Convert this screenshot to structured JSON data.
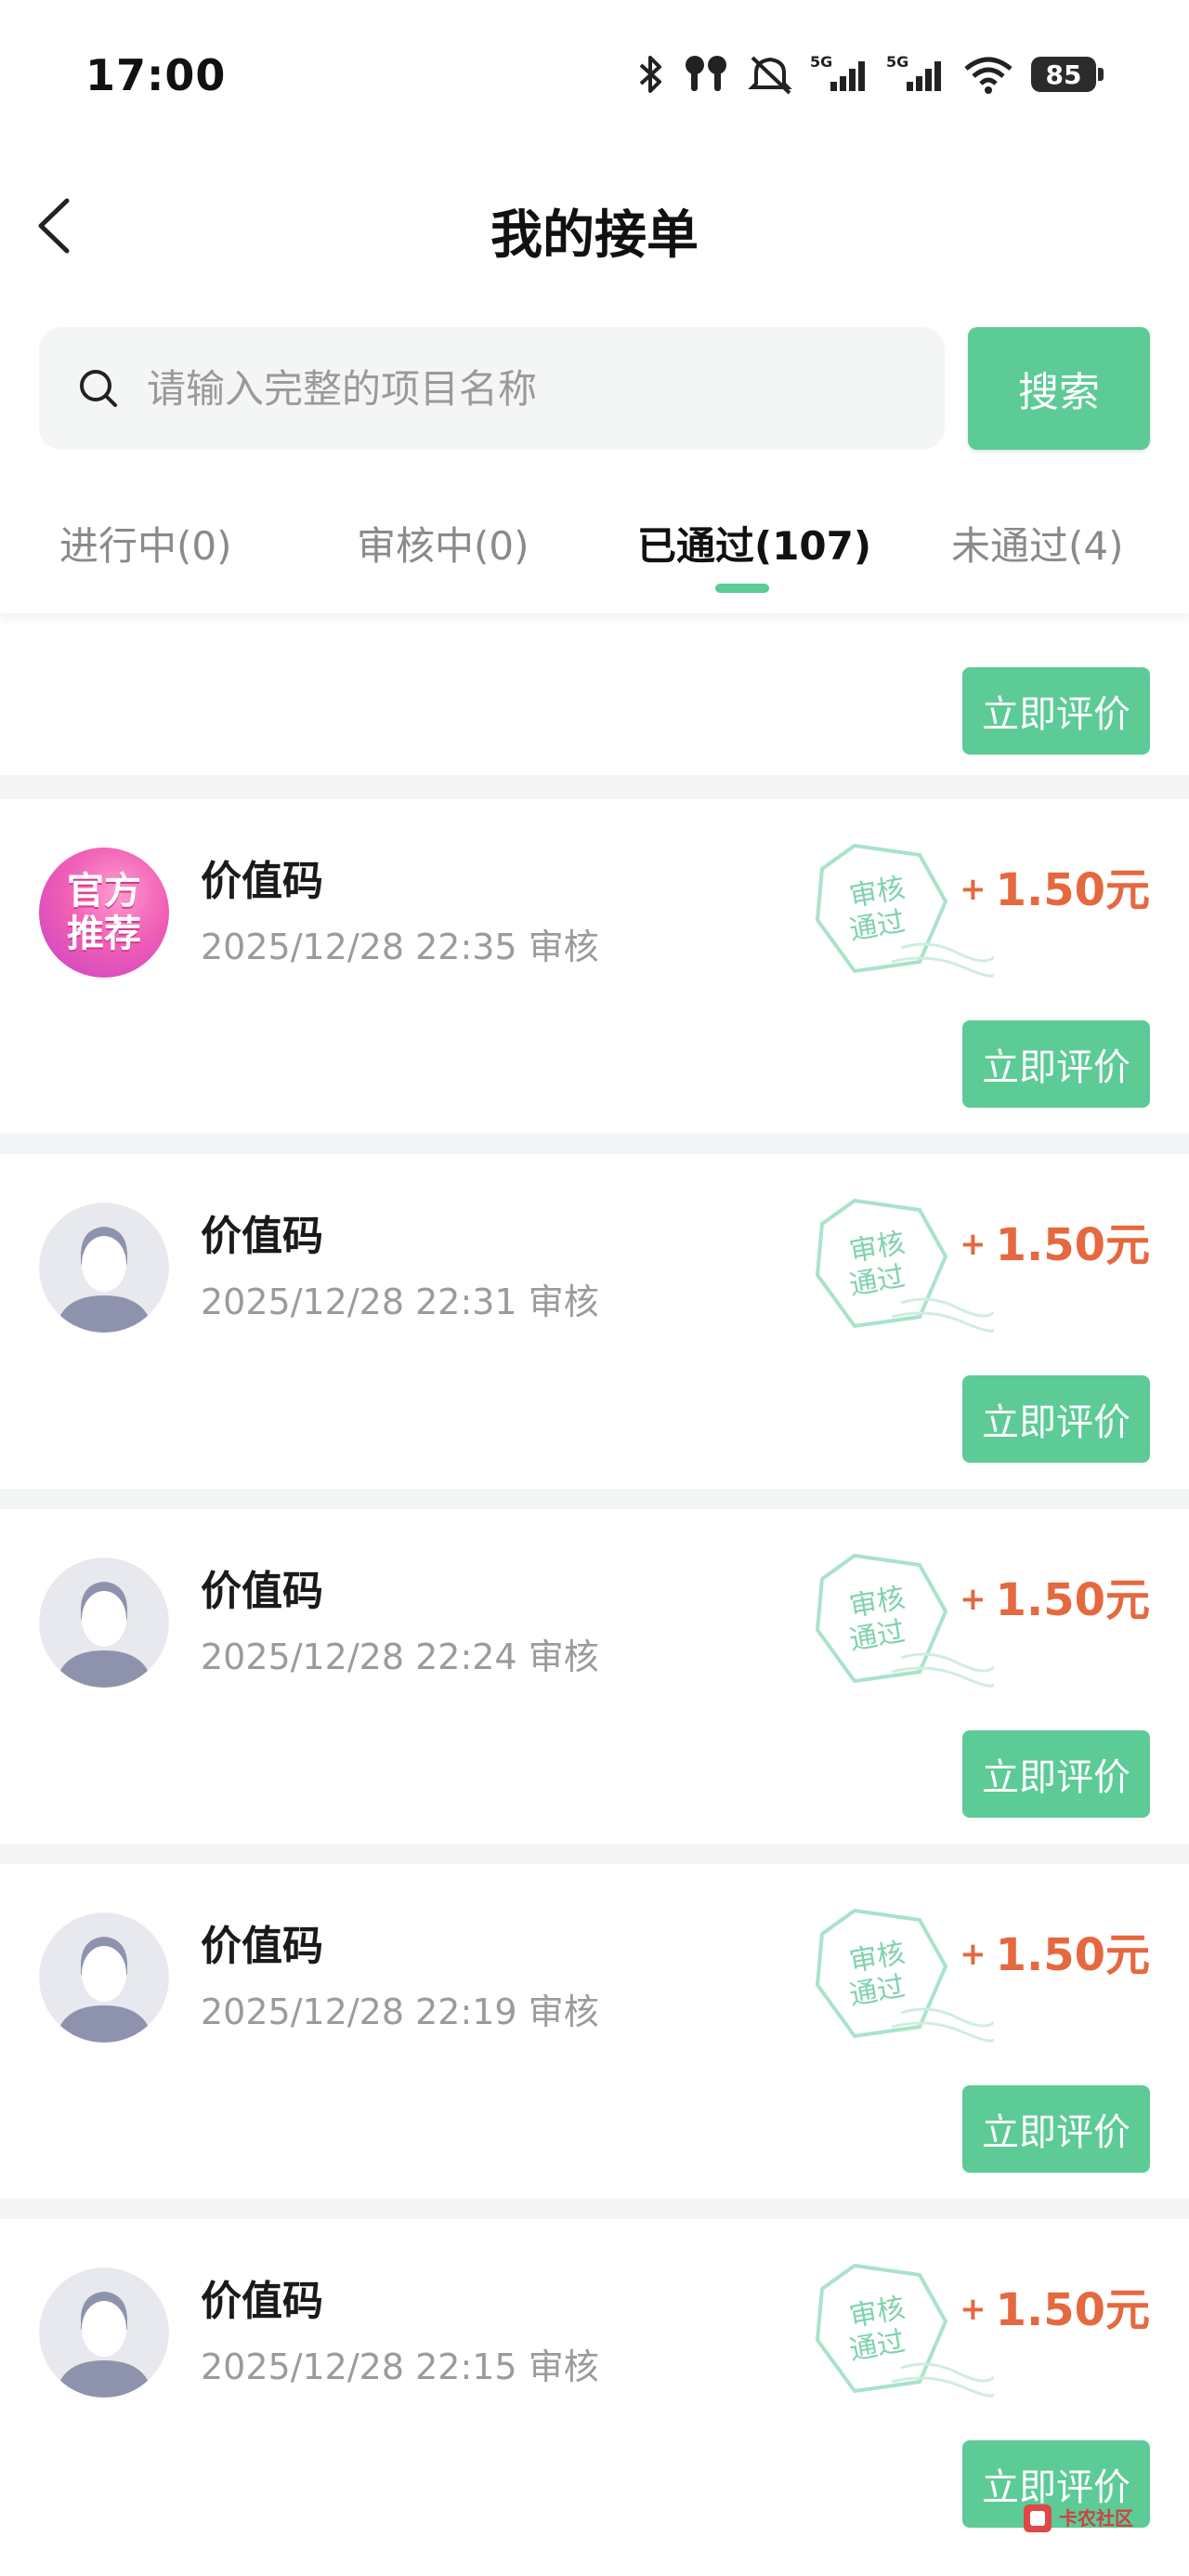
{
  "status_bar": {
    "time": "17:00",
    "battery": "85"
  },
  "nav": {
    "title": "我的接单"
  },
  "search": {
    "placeholder": "请输入完整的项目名称",
    "button": "搜索"
  },
  "tabs": [
    {
      "label": "进行中(0)",
      "active": false
    },
    {
      "label": "审核中(0)",
      "active": false
    },
    {
      "label": "已通过(107)",
      "active": true
    },
    {
      "label": "未通过(4)",
      "active": false
    }
  ],
  "stamp_text": {
    "line1": "审核",
    "line2": "通过"
  },
  "rate_button": "立即评价",
  "avatar_official": {
    "line1": "官方",
    "line2": "推荐"
  },
  "items": [
    {
      "title": "价值码",
      "time": "2025/12/28 22:35 审核",
      "reward": "1.50元",
      "avatar": "official"
    },
    {
      "title": "价值码",
      "time": "2025/12/28 22:31 审核",
      "reward": "1.50元",
      "avatar": "default"
    },
    {
      "title": "价值码",
      "time": "2025/12/28 22:24 审核",
      "reward": "1.50元",
      "avatar": "default"
    },
    {
      "title": "价值码",
      "time": "2025/12/28 22:19 审核",
      "reward": "1.50元",
      "avatar": "default"
    },
    {
      "title": "价值码",
      "time": "2025/12/28 22:15 审核",
      "reward": "1.50元",
      "avatar": "default"
    }
  ],
  "colors": {
    "accent": "#5ccb96",
    "reward": "#e5683f"
  },
  "icons": [
    "back-icon",
    "search-icon",
    "bluetooth-icon",
    "earbuds-icon",
    "mute-icon",
    "signal-5g-icon",
    "wifi-icon",
    "battery-icon"
  ]
}
